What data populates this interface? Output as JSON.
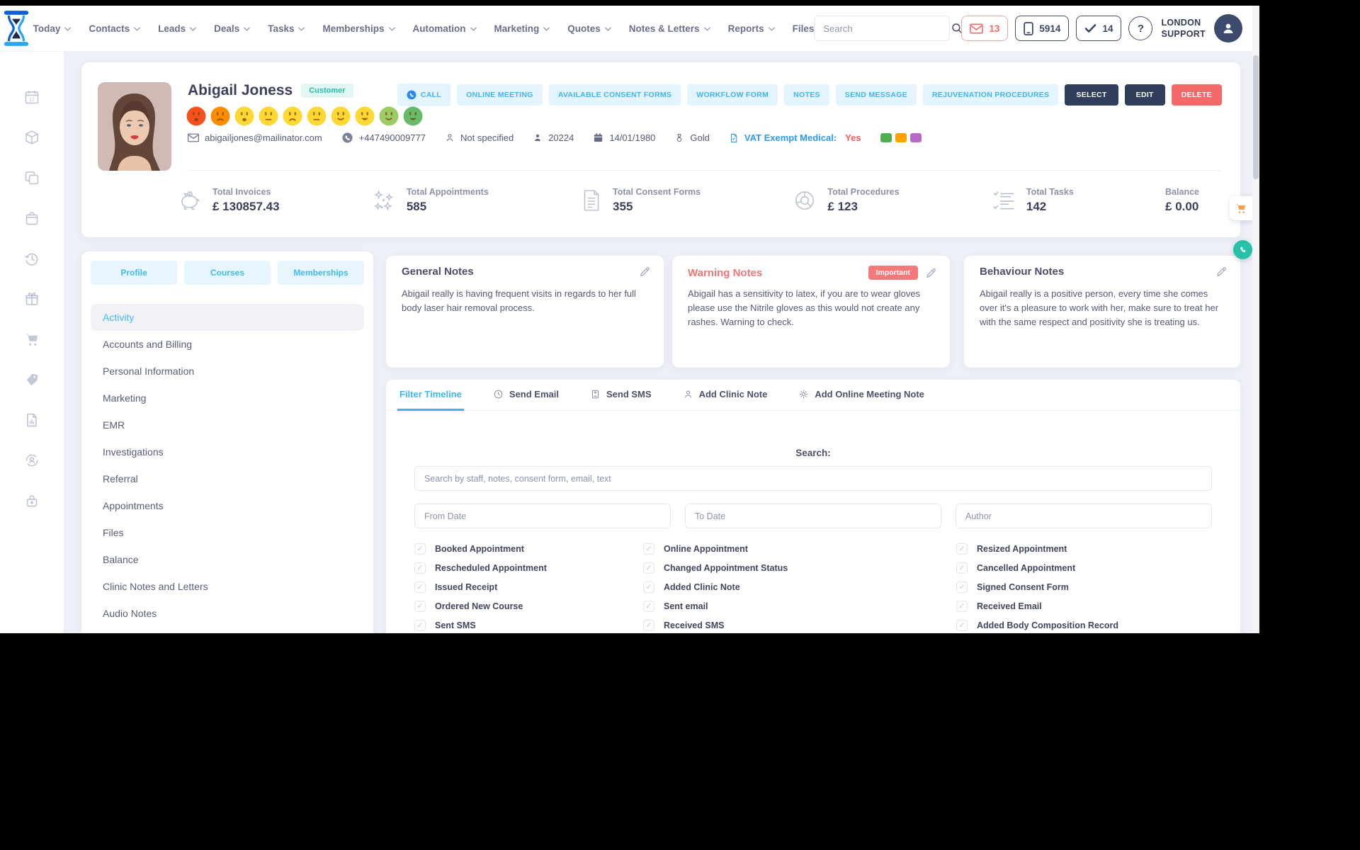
{
  "topbar": {
    "nav": [
      {
        "label": "Today",
        "chevron": true
      },
      {
        "label": "Contacts",
        "chevron": true
      },
      {
        "label": "Leads",
        "chevron": true
      },
      {
        "label": "Deals",
        "chevron": true
      },
      {
        "label": "Tasks",
        "chevron": true
      },
      {
        "label": "Memberships",
        "chevron": true
      },
      {
        "label": "Automation",
        "chevron": true
      },
      {
        "label": "Marketing",
        "chevron": true
      },
      {
        "label": "Quotes",
        "chevron": true
      },
      {
        "label": "Notes & Letters",
        "chevron": true
      },
      {
        "label": "Reports",
        "chevron": true
      },
      {
        "label": "Files",
        "chevron": false
      }
    ],
    "search_placeholder": "Search",
    "badges": {
      "messages": "13",
      "phone": "5914",
      "tasks": "14",
      "help": "?"
    },
    "account": {
      "line1": "LONDON",
      "line2": "SUPPORT"
    }
  },
  "sidebar": {
    "icons": [
      "calendar-12",
      "package",
      "copy",
      "shop-bag",
      "history",
      "gift",
      "cart",
      "sales-tag",
      "report",
      "customer-sync",
      "lock"
    ]
  },
  "customer": {
    "name": "Abigail Joness",
    "type_badge": "Customer",
    "email": "abigailjones@mailinator.com",
    "phone": "+447490009777",
    "gender": "Not specified",
    "id": "20224",
    "dob": "14/01/1980",
    "tier": "Gold",
    "vat_label": "VAT Exempt Medical:",
    "vat_value": "Yes",
    "tags": [
      "#4caf50",
      "#ffa000",
      "#ba68c8"
    ],
    "satisfaction": [
      {
        "color": "#f4511e",
        "mouth": "sad-open"
      },
      {
        "color": "#fb8c00",
        "mouth": "frown"
      },
      {
        "color": "#fdd835",
        "mouth": "sad-open"
      },
      {
        "color": "#fdd835",
        "mouth": "neutral"
      },
      {
        "color": "#fdd835",
        "mouth": "frown"
      },
      {
        "color": "#fdd835",
        "mouth": "neutral"
      },
      {
        "color": "#fdd835",
        "mouth": "smile"
      },
      {
        "color": "#fdd835",
        "mouth": "grin"
      },
      {
        "color": "#9ccc65",
        "mouth": "smile"
      },
      {
        "color": "#66bb6a",
        "mouth": "grin"
      }
    ]
  },
  "actions": {
    "call": "CALL",
    "online_meeting": "ONLINE MEETING",
    "consent": "AVAILABLE CONSENT FORMS",
    "workflow": "WORKFLOW FORM",
    "notes": "NOTES",
    "send_message": "SEND MESSAGE",
    "rejuvenation": "REJUVENATION PROCEDURES",
    "select": "SELECT",
    "edit": "EDIT",
    "delete": "DELETE"
  },
  "stats": [
    {
      "icon": "piggy-bank",
      "label": "Total Invoices",
      "value": "£ 130857.43"
    },
    {
      "icon": "sparkles",
      "label": "Total Appointments",
      "value": "585"
    },
    {
      "icon": "document",
      "label": "Total Consent Forms",
      "value": "355"
    },
    {
      "icon": "donut-chart",
      "label": "Total Procedures",
      "value": "£ 123"
    },
    {
      "icon": "checklist",
      "label": "Total Tasks",
      "value": "142"
    },
    {
      "icon": "none",
      "label": "Balance",
      "value": "£ 0.00"
    }
  ],
  "profile_panel": {
    "tabs": [
      "Profile",
      "Courses",
      "Memberships"
    ],
    "active_index": 0,
    "menu": [
      "Activity",
      "Accounts and Billing",
      "Personal Information",
      "Marketing",
      "EMR",
      "Investigations",
      "Referral",
      "Appointments",
      "Files",
      "Balance",
      "Clinic Notes and Letters",
      "Audio Notes"
    ]
  },
  "notes": {
    "general": {
      "title": "General Notes",
      "text": "Abigail really is having frequent visits in regards to her full body laser hair removal process."
    },
    "warning": {
      "title": "Warning Notes",
      "badge": "Important",
      "text": "Abigail has a sensitivity to latex, if you are to wear gloves please use the Nitrile gloves as this would not create any rashes. Warning to check."
    },
    "behaviour": {
      "title": "Behaviour Notes",
      "text": "Abigail really is a positive person, every time she comes over it's a pleasure to work with her, make sure to treat her with the same respect and positivity she is treating us."
    }
  },
  "timeline": {
    "tabs": [
      {
        "label": "Filter Timeline",
        "icon": "none"
      },
      {
        "label": "Send Email",
        "icon": "clock"
      },
      {
        "label": "Send SMS",
        "icon": "id-badge"
      },
      {
        "label": "Add Clinic Note",
        "icon": "person"
      },
      {
        "label": "Add Online Meeting Note",
        "icon": "gear"
      }
    ],
    "search_label": "Search:",
    "search_placeholder": "Search by staff, notes, consent form, email, text",
    "from_placeholder": "From Date",
    "to_placeholder": "To Date",
    "author_placeholder": "Author",
    "filter_columns": [
      [
        "Booked Appointment",
        "Rescheduled Appointment",
        "Issued Receipt",
        "Ordered New Course",
        "Sent SMS"
      ],
      [
        "Online Appointment",
        "Changed Appointment Status",
        "Added Clinic Note",
        "Sent email",
        "Received SMS"
      ],
      [
        "Resized Appointment",
        "Cancelled Appointment",
        "Signed Consent Form",
        "Received Email",
        "Added Body Composition Record"
      ]
    ]
  },
  "floating": {
    "icons": [
      "cart",
      "phone"
    ]
  }
}
